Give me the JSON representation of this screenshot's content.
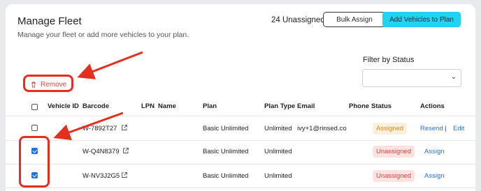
{
  "header": {
    "title": "Manage Fleet",
    "subtitle": "Manage your fleet or add more vehicles to your plan.",
    "unassigned_count": "24 Unassigned",
    "bulk_assign_label": "Bulk Assign",
    "add_vehicles_label": "Add Vehicles to Plan"
  },
  "filter": {
    "label": "Filter by Status",
    "value": ""
  },
  "toolbar": {
    "remove_label": "Remove"
  },
  "table": {
    "columns": [
      "Vehicle ID",
      "Barcode",
      "LPN",
      "Name",
      "Plan",
      "Plan Type",
      "Email",
      "Phone",
      "Status",
      "Actions"
    ],
    "rows": [
      {
        "checked": false,
        "vehicle_id": "",
        "barcode": "W-7892T27",
        "lpn": "",
        "name": "",
        "plan": "Basic Unlimited",
        "plan_type": "Unlimited",
        "email": "ivy+1@rinsed.co",
        "phone": "",
        "status": "Assigned",
        "actions": [
          "Resend",
          "|",
          "Edit"
        ]
      },
      {
        "checked": true,
        "vehicle_id": "",
        "barcode": "W-Q4N8379",
        "lpn": "",
        "name": "",
        "plan": "Basic Unlimited",
        "plan_type": "Unlimited",
        "email": "",
        "phone": "",
        "status": "Unassigned",
        "actions": [
          "Assign"
        ]
      },
      {
        "checked": true,
        "vehicle_id": "",
        "barcode": "W-NV3J2G5",
        "lpn": "",
        "name": "",
        "plan": "Basic Unlimited",
        "plan_type": "Unlimited",
        "email": "",
        "phone": "",
        "status": "Unassigned",
        "actions": [
          "Assign"
        ]
      }
    ]
  },
  "colors": {
    "accent": "#1ed4ee",
    "annotation": "#e3301e",
    "link": "#2a6fd6"
  }
}
